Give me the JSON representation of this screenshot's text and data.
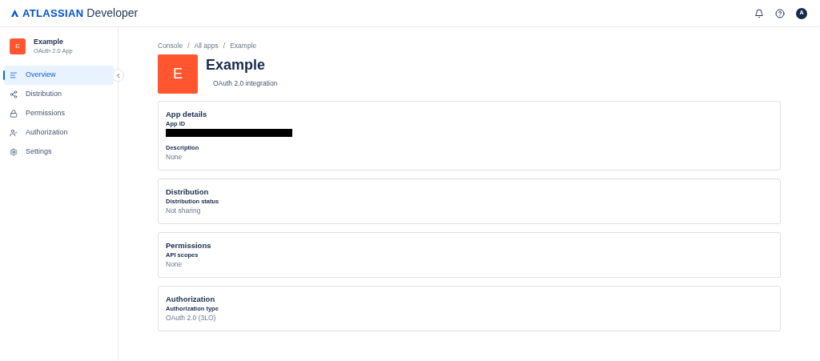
{
  "header": {
    "brand": "ATLASSIAN",
    "product": "Developer",
    "avatar": "A"
  },
  "sidebar": {
    "app_initial": "E",
    "app_name": "Example",
    "app_type": "OAuth 2.0 App",
    "items": [
      {
        "label": "Overview",
        "selected": true
      },
      {
        "label": "Distribution",
        "selected": false
      },
      {
        "label": "Permissions",
        "selected": false
      },
      {
        "label": "Authorization",
        "selected": false
      },
      {
        "label": "Settings",
        "selected": false
      }
    ]
  },
  "breadcrumb": {
    "separator": "/",
    "items": [
      "Console",
      "All apps",
      "Example"
    ]
  },
  "app": {
    "initial": "E",
    "name": "Example",
    "subtitle": "OAuth 2.0 integration"
  },
  "cards": [
    {
      "title": "App details",
      "fields": [
        {
          "label": "App ID",
          "redacted": true
        },
        {
          "label": "Description",
          "value": "None"
        }
      ]
    },
    {
      "title": "Distribution",
      "fields": [
        {
          "label": "Distribution status",
          "value": "Not sharing"
        }
      ]
    },
    {
      "title": "Permissions",
      "fields": [
        {
          "label": "API scopes",
          "value": "None"
        }
      ]
    },
    {
      "title": "Authorization",
      "fields": [
        {
          "label": "Authorization type",
          "value": "OAuth 2.0 (3LO)"
        }
      ]
    }
  ]
}
